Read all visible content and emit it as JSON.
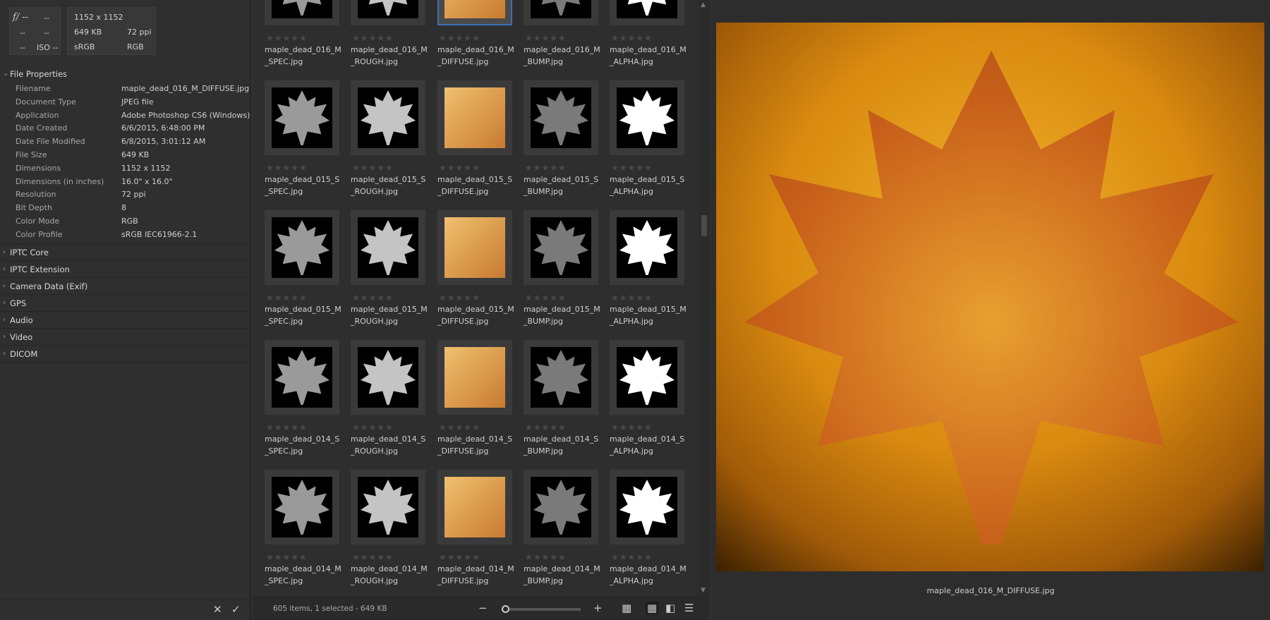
{
  "camera": {
    "aperture": "f/ --",
    "shutter": "--",
    "r2a": "--",
    "r2b": "--",
    "r3a": "--",
    "iso": "ISO --"
  },
  "summary": {
    "dimensions": "1152 x 1152",
    "size": "649 KB",
    "resolution": "72 ppi",
    "profile": "sRGB",
    "mode": "RGB"
  },
  "file_properties": {
    "title": "File Properties",
    "rows": [
      {
        "k": "Filename",
        "v": "maple_dead_016_M_DIFFUSE.jpg"
      },
      {
        "k": "Document Type",
        "v": "JPEG file"
      },
      {
        "k": "Application",
        "v": "Adobe Photoshop CS6 (Windows)"
      },
      {
        "k": "Date Created",
        "v": "6/6/2015, 6:48:00 PM"
      },
      {
        "k": "Date File Modified",
        "v": "6/8/2015, 3:01:12 AM"
      },
      {
        "k": "File Size",
        "v": "649 KB"
      },
      {
        "k": "Dimensions",
        "v": "1152 x 1152"
      },
      {
        "k": "Dimensions (in inches)",
        "v": "16.0\" x 16.0\""
      },
      {
        "k": "Resolution",
        "v": "72 ppi"
      },
      {
        "k": "Bit Depth",
        "v": "8"
      },
      {
        "k": "Color Mode",
        "v": "RGB"
      },
      {
        "k": "Color Profile",
        "v": "sRGB IEC61966-2.1"
      }
    ]
  },
  "sections": [
    "IPTC Core",
    "IPTC Extension",
    "Camera Data (Exif)",
    "GPS",
    "Audio",
    "Video",
    "DICOM"
  ],
  "left_actions": {
    "cancel": "✕",
    "apply": "✓"
  },
  "thumb_rows": [
    {
      "prefix": "maple_dead_016_M",
      "selected": "DIFFUSE"
    },
    {
      "prefix": "maple_dead_015_S"
    },
    {
      "prefix": "maple_dead_015_M"
    },
    {
      "prefix": "maple_dead_014_S"
    },
    {
      "prefix": "maple_dead_014_M"
    }
  ],
  "map_types": [
    "SPEC",
    "ROUGH",
    "DIFFUSE",
    "BUMP",
    "ALPHA"
  ],
  "map_colors": {
    "SPEC": "#9a9a9a",
    "ROUGH": "#c4c4c4",
    "DIFFUSE": "#d9912e",
    "BUMP": "#7a7a7a",
    "ALPHA": "#ffffff"
  },
  "stars": "★★★★★",
  "status": {
    "text": "605 items, 1 selected - 649 KB",
    "minus": "−",
    "plus": "+",
    "view_grid": "▦",
    "view_thumbs": "▦",
    "view_details": "◧",
    "view_list": "☰"
  },
  "preview": {
    "caption": "maple_dead_016_M_DIFFUSE.jpg"
  },
  "scroll": {
    "up": "▲",
    "down": "▼"
  }
}
